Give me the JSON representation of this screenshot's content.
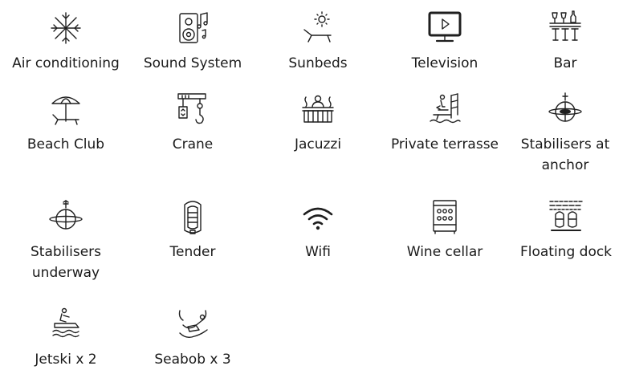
{
  "amenities": [
    {
      "label": "Air conditioning",
      "icon": "snowflake-icon"
    },
    {
      "label": "Sound System",
      "icon": "speaker-music-icon"
    },
    {
      "label": "Sunbeds",
      "icon": "sunbed-icon"
    },
    {
      "label": "Television",
      "icon": "television-icon"
    },
    {
      "label": "Bar",
      "icon": "bar-icon"
    },
    {
      "label": "Beach Club",
      "icon": "beach-umbrella-icon"
    },
    {
      "label": "Crane",
      "icon": "crane-icon"
    },
    {
      "label": "Jacuzzi",
      "icon": "jacuzzi-icon"
    },
    {
      "label": "Private terrasse",
      "icon": "terrace-icon"
    },
    {
      "label": "Stabilisers at anchor",
      "icon": "stabiliser-anchor-icon"
    },
    {
      "label": "Stabilisers underway",
      "icon": "stabiliser-underway-icon"
    },
    {
      "label": "Tender",
      "icon": "tender-boat-icon"
    },
    {
      "label": "Wifi",
      "icon": "wifi-icon"
    },
    {
      "label": "Wine cellar",
      "icon": "wine-cellar-icon"
    },
    {
      "label": "Floating dock",
      "icon": "floating-dock-icon"
    },
    {
      "label": "Jetski x 2",
      "icon": "jetski-icon"
    },
    {
      "label": "Seabob x 3",
      "icon": "seabob-icon"
    }
  ]
}
